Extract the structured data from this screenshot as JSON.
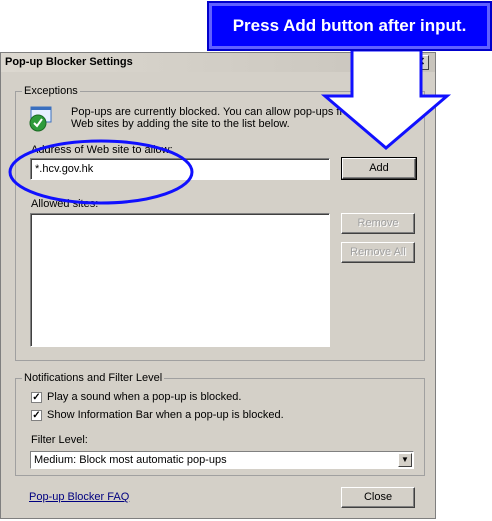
{
  "callout": {
    "text": "Press Add button after input."
  },
  "dialog": {
    "title": "Pop-up Blocker Settings",
    "close_glyph": "✕",
    "exceptions": {
      "legend": "Exceptions",
      "info_line1": "Pop-ups are currently blocked.  You can allow pop-ups fro",
      "info_line2": "Web sites by adding the site to the list below.",
      "address_label": "Address of Web site to allow:",
      "address_value": "*.hcv.gov.hk",
      "add_label": "Add",
      "allowed_label": "Allowed sites:",
      "remove_label": "Remove",
      "remove_all_label": "Remove All"
    },
    "notifications": {
      "legend": "Notifications and Filter Level",
      "play_sound_label": "Play a sound when a pop-up is blocked.",
      "play_sound_checked": true,
      "info_bar_label": "Show Information Bar when a pop-up is blocked.",
      "info_bar_checked": true,
      "filter_level_label": "Filter Level:",
      "filter_level_value": "Medium: Block most automatic pop-ups"
    },
    "faq_link": "Pop-up Blocker FAQ",
    "close_label": "Close"
  },
  "colors": {
    "annotation": "#0000ff",
    "dialog_bg": "#d4d0c8",
    "link": "#000080"
  },
  "icons": {
    "exceptions_icon": "shield-check-icon",
    "dropdown_icon": "chevron-down-icon",
    "check_icon": "checkmark-icon"
  }
}
